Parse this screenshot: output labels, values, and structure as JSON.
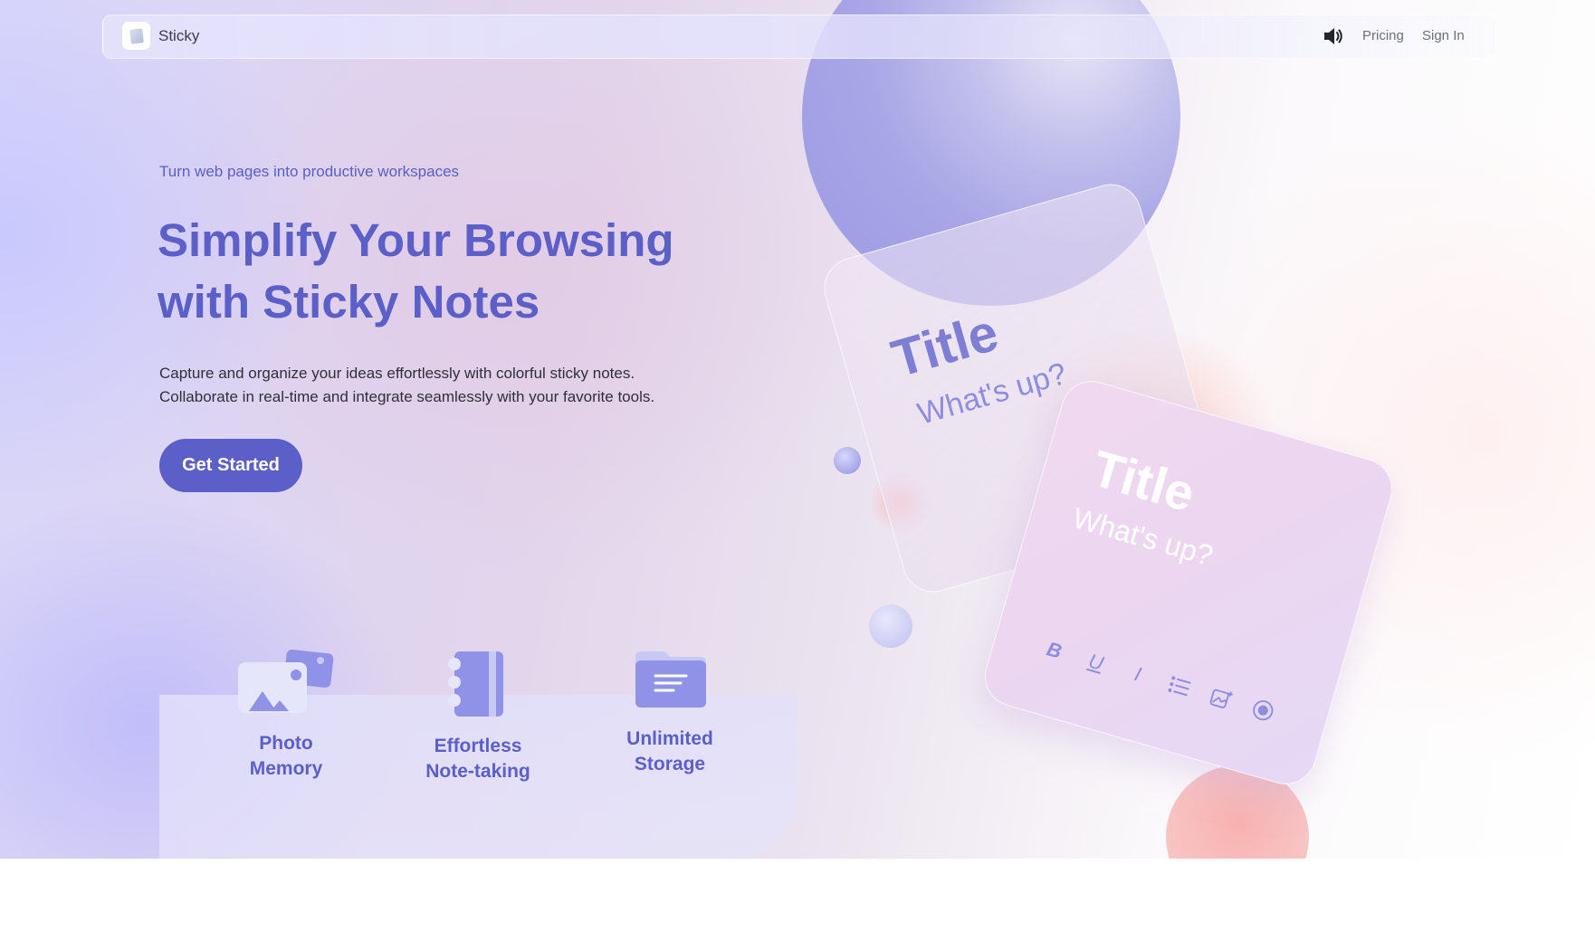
{
  "nav": {
    "brand": "Sticky",
    "links": {
      "pricing": "Pricing",
      "sign_in": "Sign In"
    },
    "icons": {
      "logo": "sticky-note-logo-icon",
      "sound": "speaker-icon"
    }
  },
  "hero": {
    "eyebrow": "Turn web pages into productive workspaces",
    "headline_line1": "Simplify Your Browsing",
    "headline_line2": "with Sticky Notes",
    "description_line1": "Capture and organize your ideas effortlessly with colorful sticky notes.",
    "description_line2": "Collaborate in real-time and integrate seamlessly with your favorite tools.",
    "cta": "Get Started"
  },
  "notes": {
    "back": {
      "title": "Title",
      "body": "What's up?"
    },
    "front": {
      "title": "Title",
      "body": "What's up?",
      "toolbar": {
        "bold": "B",
        "underline": "U",
        "italic": "I"
      }
    }
  },
  "features": [
    {
      "line1": "Photo",
      "line2": "Memory",
      "icon": "photo-icon"
    },
    {
      "line1": "Effortless",
      "line2": "Note-taking",
      "icon": "notebook-icon"
    },
    {
      "line1": "Unlimited",
      "line2": "Storage",
      "icon": "folder-icon"
    }
  ],
  "colors": {
    "accent": "#5b5fc7",
    "note_accent": "#8b8ee0",
    "sphere": "#9c9ae4",
    "sphere_red": "#f8b2b0"
  }
}
